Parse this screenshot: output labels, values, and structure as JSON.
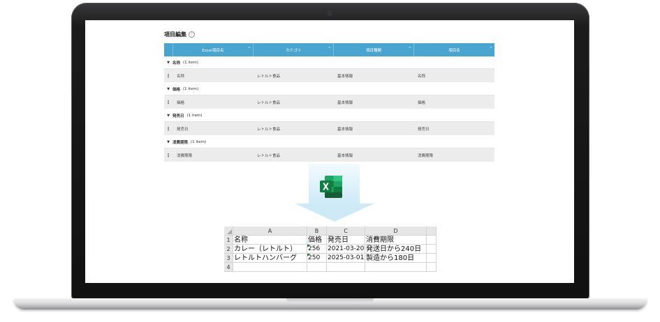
{
  "panel": {
    "title": "項目編集",
    "info_icon": "info-circle-icon",
    "columns": [
      "Excel項目名",
      "カテゴリ",
      "項目種類",
      "項目名"
    ],
    "groups": [
      {
        "name": "名称",
        "count": "(1 item)",
        "row": [
          "名称",
          "レトルト食品",
          "基本情報",
          "名称"
        ]
      },
      {
        "name": "価格",
        "count": "(1 item)",
        "row": [
          "価格",
          "レトルト食品",
          "基本情報",
          "価格"
        ]
      },
      {
        "name": "発売日",
        "count": "(1 item)",
        "row": [
          "発売日",
          "レトルト食品",
          "基本情報",
          "発売日"
        ]
      },
      {
        "name": "消費期限",
        "count": "(1 item)",
        "row": [
          "消費期限",
          "レトルト食品",
          "基本情報",
          "消費期限"
        ]
      }
    ],
    "header_color": "#4aa4d0"
  },
  "arrow_icon": "down-arrow-icon",
  "excel_icon": "excel-icon",
  "sheet": {
    "col_headers": [
      "A",
      "B",
      "C",
      "D"
    ],
    "row_numbers": [
      "1",
      "2",
      "3",
      "4"
    ],
    "rows": [
      [
        "名称",
        "価格",
        "発売日",
        "消費期限"
      ],
      [
        "カレー（レトルト）",
        "256",
        "2021-03-20",
        "発送日から240日"
      ],
      [
        "レトルトハンバーグ",
        "250",
        "2025-03-01",
        "製造から180日"
      ]
    ]
  }
}
